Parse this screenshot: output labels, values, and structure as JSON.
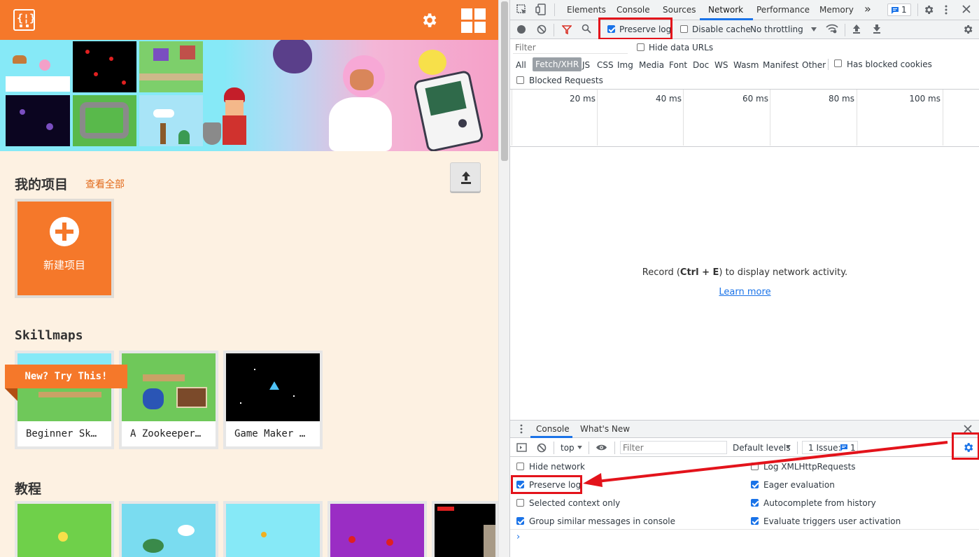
{
  "left": {
    "section_my_projects": "我的项目",
    "view_all": "查看全部",
    "new_project": "新建项目",
    "section_skillmaps": "Skillmaps",
    "try_this": "New? Try This!",
    "skillmaps": [
      {
        "caption": "Beginner Sk…"
      },
      {
        "caption": "A Zookeeper…"
      },
      {
        "caption": "Game Maker …"
      }
    ],
    "section_tutorials": "教程"
  },
  "devtools": {
    "tabs": [
      "Elements",
      "Console",
      "Sources",
      "Network",
      "Performance",
      "Memory"
    ],
    "more": "»",
    "issues_badge": "1",
    "toolbar": {
      "preserve_log": "Preserve log",
      "disable_cache": "Disable cache",
      "throttling": "No throttling"
    },
    "filter_placeholder": "Filter",
    "hide_data_urls": "Hide data URLs",
    "type_filters": [
      "All",
      "Fetch/XHR",
      "JS",
      "CSS",
      "Img",
      "Media",
      "Font",
      "Doc",
      "WS",
      "Wasm",
      "Manifest",
      "Other"
    ],
    "has_blocked_cookies": "Has blocked cookies",
    "blocked_requests": "Blocked Requests",
    "ticks": [
      "20 ms",
      "40 ms",
      "60 ms",
      "80 ms",
      "100 ms"
    ],
    "empty_prefix": "Record (",
    "empty_keys": "Ctrl + E",
    "empty_suffix": ") to display network activity.",
    "learn_more": "Learn more",
    "drawer": {
      "tabs": [
        "Console",
        "What's New"
      ],
      "context": "top",
      "filter_placeholder": "Filter",
      "levels": "Default levels",
      "issues": "1 Issue:",
      "issues_count": "1",
      "settings": [
        {
          "label": "Hide network",
          "checked": false
        },
        {
          "label": "Log XMLHttpRequests",
          "checked": false
        },
        {
          "label": "Preserve log",
          "checked": true
        },
        {
          "label": "Eager evaluation",
          "checked": true
        },
        {
          "label": "Selected context only",
          "checked": false
        },
        {
          "label": "Autocomplete from history",
          "checked": true
        },
        {
          "label": "Group similar messages in console",
          "checked": true
        },
        {
          "label": "Evaluate triggers user activation",
          "checked": true
        }
      ],
      "prompt": "›"
    }
  },
  "colors": {
    "brand": "#f5782a",
    "page_bg": "#fdf1e2",
    "accent_blue": "#1a73e8",
    "highlight_red": "#e3131b"
  }
}
